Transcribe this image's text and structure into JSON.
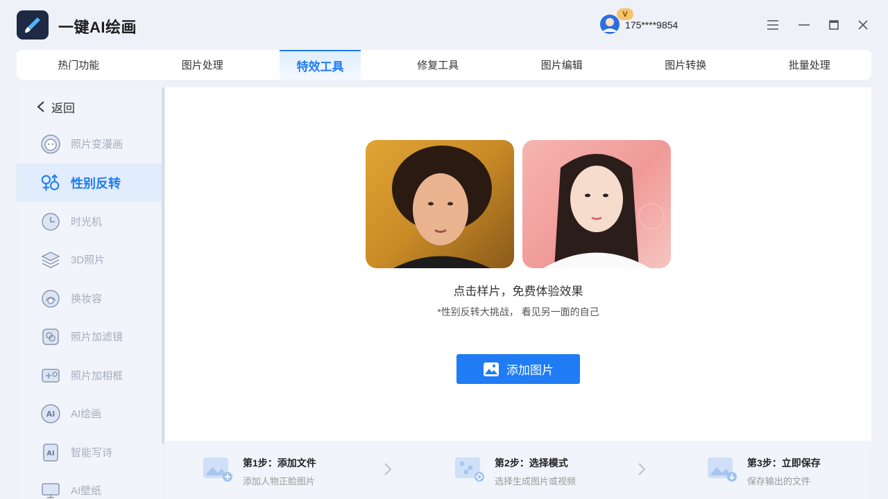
{
  "app": {
    "title": "一键AI绘画",
    "user_phone": "175****9854",
    "vip_badge": "V"
  },
  "tabs": [
    {
      "label": "热门功能",
      "active": false
    },
    {
      "label": "图片处理",
      "active": false
    },
    {
      "label": "特效工具",
      "active": true
    },
    {
      "label": "修复工具",
      "active": false
    },
    {
      "label": "图片编辑",
      "active": false
    },
    {
      "label": "图片转换",
      "active": false
    },
    {
      "label": "批量处理",
      "active": false
    }
  ],
  "sidebar": {
    "back_label": "返回",
    "items": [
      {
        "label": "照片变漫画",
        "icon": "bear-face-icon",
        "active": false
      },
      {
        "label": "性别反转",
        "icon": "gender-symbol-icon",
        "active": true
      },
      {
        "label": "时光机",
        "icon": "clock-icon",
        "active": false
      },
      {
        "label": "3D照片",
        "icon": "layers-icon",
        "active": false
      },
      {
        "label": "换妆容",
        "icon": "makeup-face-icon",
        "active": false
      },
      {
        "label": "照片加滤镜",
        "icon": "filter-icon",
        "active": false
      },
      {
        "label": "照片加相框",
        "icon": "frame-icon",
        "active": false
      },
      {
        "label": "AI绘画",
        "icon": "ai-circle-icon",
        "active": false
      },
      {
        "label": "智能写诗",
        "icon": "ai-doc-icon",
        "active": false
      },
      {
        "label": "AI壁纸",
        "icon": "wallpaper-icon",
        "active": false
      }
    ]
  },
  "main": {
    "sample_hint": "点击样片，免费体验效果",
    "sub_hint": "*性别反转大挑战，  看见另一面的自己",
    "add_button": "添加图片"
  },
  "steps": [
    {
      "title": "第1步：添加文件",
      "desc": "添加人物正脸图片",
      "icon": "add-image-icon"
    },
    {
      "title": "第2步：选择模式",
      "desc": "选择生成图片或视频",
      "icon": "mode-image-icon"
    },
    {
      "title": "第3步：立即保存",
      "desc": "保存输出的文件",
      "icon": "save-image-icon"
    }
  ],
  "colors": {
    "accent": "#1f7cf4",
    "background": "#eef1f7",
    "sidebar_inactive_text": "#a5adbd",
    "vip_gold": "#f5c36b"
  }
}
